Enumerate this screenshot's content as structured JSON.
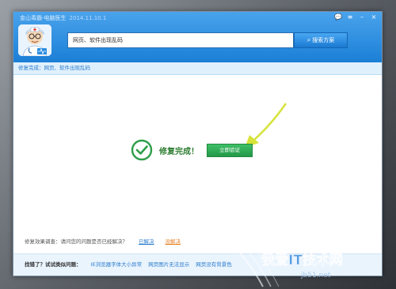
{
  "window": {
    "title": "金山毒霸-电脑医生",
    "version": "2014.11.10.1",
    "controls": [
      "💬",
      "≡",
      "–",
      "×"
    ]
  },
  "search": {
    "query": "网页、软件出现乱码",
    "button_label": "搜索方案",
    "button_icon": "search-icon"
  },
  "status_bar": {
    "text": "修复完成：网页、软件出现乱码"
  },
  "result": {
    "title": "修复完成！",
    "verify_button": "立即验证",
    "icon": "check-circle-icon"
  },
  "survey": {
    "prompt": "修复效果调查：请问您的问题是否已经解决？",
    "yes_label": "已解决",
    "no_label": "没解决"
  },
  "footer": {
    "label": "找错了？试试类似问题：",
    "questions": [
      "IE浏览器字体大小异常",
      "网页图片无法显示",
      "网页没有背景色"
    ]
  },
  "watermark": {
    "text": "我爱IT技术网",
    "domain": "jb51.net"
  },
  "colors": {
    "header_blue": "#2b8de0",
    "success_green": "#2e9e4a",
    "link_blue": "#2a7bcc",
    "warning_orange": "#e67e22",
    "arrow_yellow": "#d7e33a"
  }
}
